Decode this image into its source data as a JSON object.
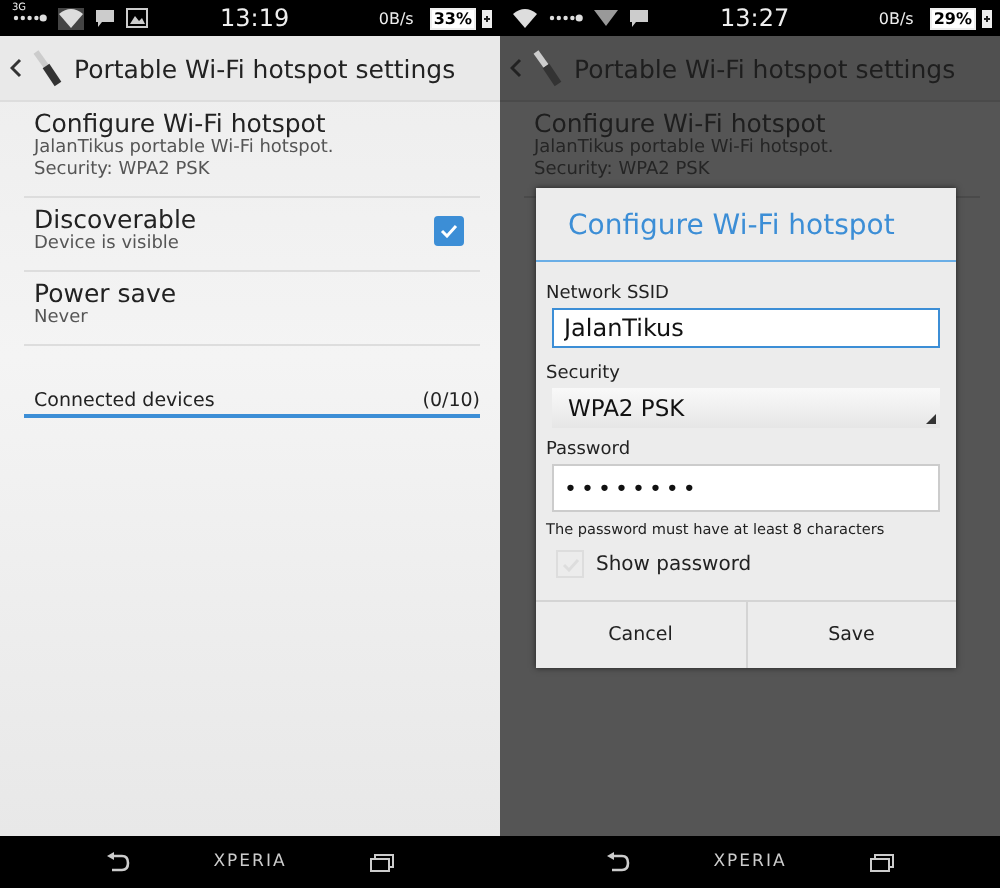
{
  "screens": [
    {
      "dimmed": false,
      "status_bar": {
        "network": "3G",
        "time": "13:19",
        "speed": "0B/s",
        "battery": "33%",
        "icons": [
          {
            "kind": "signal"
          },
          {
            "kind": "wifi"
          },
          {
            "kind": "chat"
          },
          {
            "kind": "image"
          }
        ]
      },
      "title": "Portable Wi-Fi hotspot settings",
      "settings": [
        {
          "kind": "text",
          "title": "Configure Wi-Fi hotspot",
          "subtitle": [
            "JalanTikus portable Wi-Fi hotspot.",
            "Security: WPA2 PSK"
          ]
        },
        {
          "kind": "checkbox",
          "title": "Discoverable",
          "subtitle": [
            "Device is visible"
          ],
          "checked": true
        },
        {
          "kind": "text",
          "title": "Power save",
          "subtitle": [
            "Never"
          ]
        }
      ],
      "section": {
        "label": "Connected devices",
        "count": "(0/10)"
      },
      "nav": {
        "brand": "XPERIA"
      }
    },
    {
      "dimmed": true,
      "status_bar": {
        "time": "13:27",
        "speed": "0B/s",
        "battery": "29%",
        "icons": [
          {
            "kind": "wifi"
          },
          {
            "kind": "signal"
          },
          {
            "kind": "signal-down"
          },
          {
            "kind": "chat"
          }
        ]
      },
      "title": "Portable Wi-Fi hotspot settings",
      "settings": [
        {
          "kind": "text",
          "title": "Configure Wi-Fi hotspot",
          "subtitle": [
            "JalanTikus portable Wi-Fi hotspot.",
            "Security: WPA2 PSK"
          ]
        }
      ],
      "dialog": {
        "title": "Configure Wi-Fi hotspot",
        "ssid": {
          "label": "Network SSID",
          "value": "JalanTikus"
        },
        "security": {
          "label": "Security",
          "value": "WPA2 PSK"
        },
        "password": {
          "label": "Password",
          "value": "••••••••",
          "hint": "The password must have at least 8 characters"
        },
        "show_password": {
          "label": "Show password",
          "checked": false
        },
        "buttons": [
          "Cancel",
          "Save"
        ]
      },
      "nav": {
        "brand": "XPERIA"
      }
    }
  ]
}
